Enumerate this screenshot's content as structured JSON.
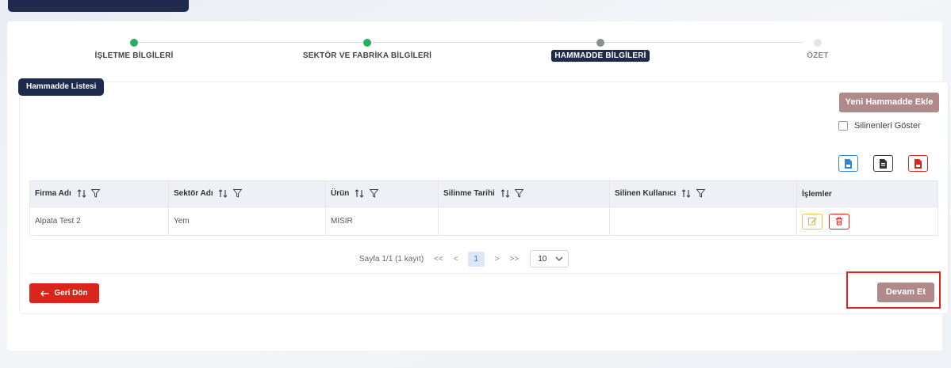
{
  "colors": {
    "navy": "#1f2b4d",
    "step_complete": "#27ae60",
    "step_current": "#8a8f96",
    "step_upcoming": "#e3e5e8",
    "primary_muted": "#b08a8a",
    "danger": "#d9261c",
    "highlight": "#e02424"
  },
  "stepper": {
    "steps": [
      {
        "label": "İŞLETME BİLGİLERİ",
        "state": "complete"
      },
      {
        "label": "SEKTÖR VE FABRİKA BİLGİLERİ",
        "state": "complete"
      },
      {
        "label": "HAMMADDE BİLGİLERİ",
        "state": "current"
      },
      {
        "label": "ÖZET",
        "state": "upcoming"
      }
    ]
  },
  "section": {
    "title": "Hammadde Listesi"
  },
  "toolbar": {
    "new_button": "Yeni Hammadde Ekle",
    "show_deleted_label": "Silinenleri Göster",
    "exports": [
      {
        "icon": "csv-file-icon",
        "color": "#2e86de"
      },
      {
        "icon": "file-icon",
        "color": "#333333"
      },
      {
        "icon": "pdf-file-icon",
        "color": "#d9261c"
      }
    ]
  },
  "table": {
    "columns": [
      "Firma Adı",
      "Sektör Adı",
      "Ürün",
      "Silinme Tarihi",
      "Silinen Kullanıcı",
      "İşlemler"
    ],
    "rows": [
      {
        "firma": "Alpata Test 2",
        "sektor": "Yem",
        "urun": "MISIR",
        "silinme_tarihi": "",
        "silinen_kullanici": ""
      }
    ]
  },
  "pagination": {
    "summary": "Sayfa 1/1 (1 kayıt)",
    "first": "<<",
    "prev": "<",
    "current": "1",
    "next": ">",
    "last": ">>",
    "page_size": "10"
  },
  "footer": {
    "back_button": "Geri Dön",
    "continue_button": "Devam Et"
  }
}
